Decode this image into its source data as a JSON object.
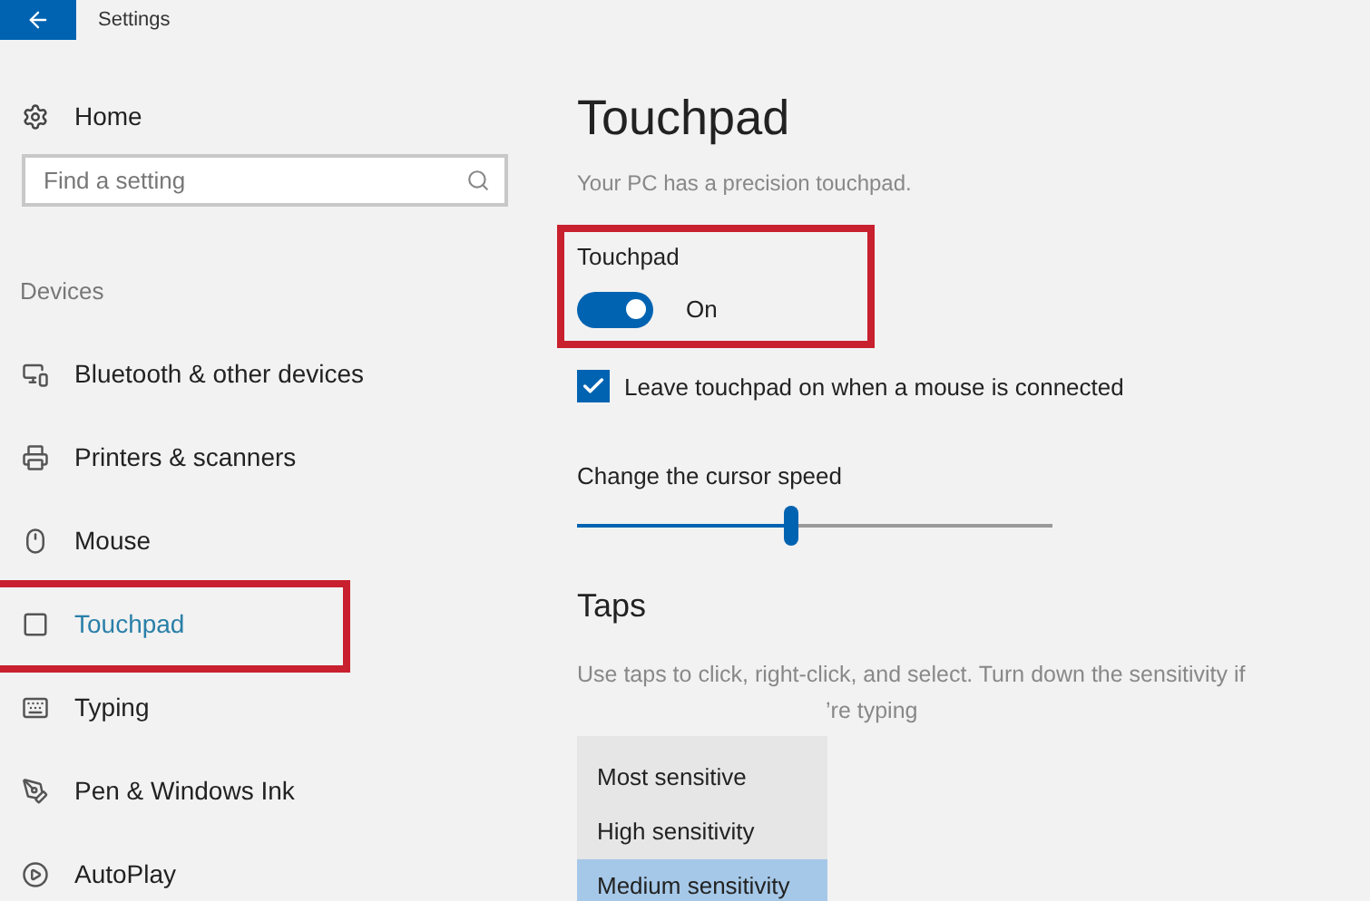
{
  "window": {
    "title": "Settings"
  },
  "sidebar": {
    "home": "Home",
    "search": {
      "placeholder": "Find a setting"
    },
    "section": "Devices",
    "items": [
      {
        "label": "Bluetooth & other devices",
        "selected": false
      },
      {
        "label": "Printers & scanners",
        "selected": false
      },
      {
        "label": "Mouse",
        "selected": false
      },
      {
        "label": "Touchpad",
        "selected": true
      },
      {
        "label": "Typing",
        "selected": false
      },
      {
        "label": "Pen & Windows Ink",
        "selected": false
      },
      {
        "label": "AutoPlay",
        "selected": false
      }
    ]
  },
  "content": {
    "title": "Touchpad",
    "subtitle": "Your PC has a precision touchpad.",
    "toggle": {
      "label": "Touchpad",
      "on": true,
      "state_text": "On"
    },
    "checkbox": {
      "label": "Leave touchpad on when a mouse is connected",
      "checked": true
    },
    "slider": {
      "label": "Change the cursor speed",
      "level": 0.45
    },
    "taps": {
      "heading": "Taps",
      "description": "Use taps to click, right-click, and select. Turn down the sensitivity if",
      "description_tail": "’re typing",
      "dropdown": [
        {
          "label": "Most sensitive",
          "selected": false
        },
        {
          "label": "High sensitivity",
          "selected": false
        },
        {
          "label": "Medium sensitivity",
          "selected": true
        }
      ]
    }
  }
}
